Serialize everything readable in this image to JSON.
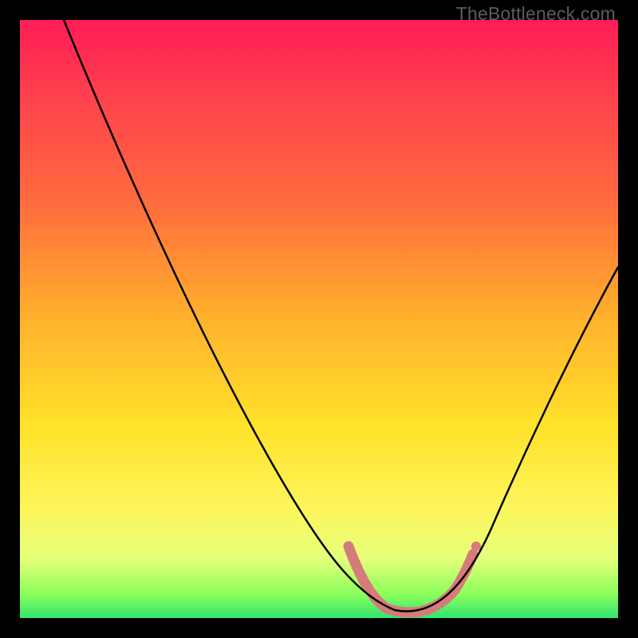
{
  "brand": "TheBottleneck.com",
  "colors": {
    "curve": "#000000",
    "highlight": "#d57b7b",
    "background_black": "#000000"
  },
  "chart_data": {
    "type": "line",
    "title": "",
    "xlabel": "",
    "ylabel": "",
    "xlim": [
      0,
      100
    ],
    "ylim": [
      0,
      100
    ],
    "grid": false,
    "series": [
      {
        "name": "bottleneck-curve",
        "x": [
          0,
          5,
          10,
          15,
          20,
          25,
          30,
          35,
          40,
          45,
          50,
          55,
          58,
          60,
          62,
          65,
          68,
          70,
          72,
          75,
          80,
          85,
          90,
          95,
          100
        ],
        "values": [
          100,
          92,
          84,
          76,
          68,
          60,
          52,
          44,
          36,
          28,
          20,
          12,
          7,
          4,
          2,
          1,
          1,
          2,
          4,
          8,
          17,
          27,
          37,
          47,
          57
        ]
      }
    ],
    "highlight_range": {
      "x_start": 55,
      "x_end": 75
    },
    "annotations": []
  }
}
